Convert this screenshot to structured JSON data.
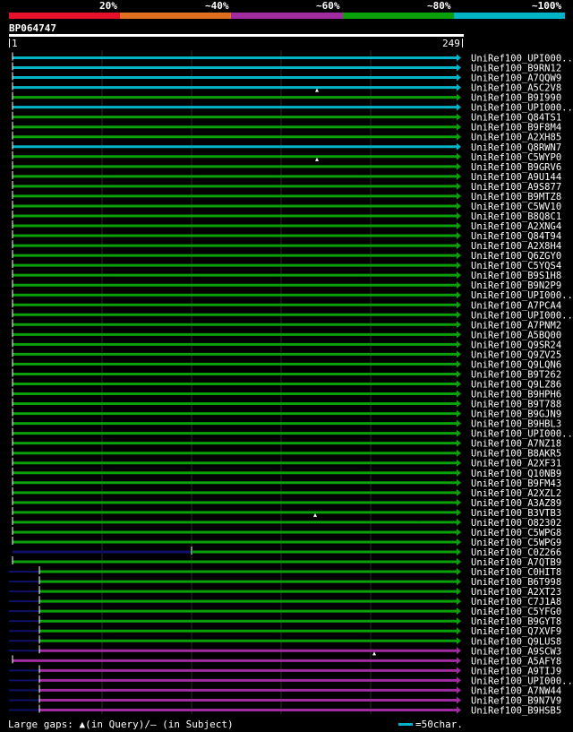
{
  "scale": {
    "labels": [
      "20%",
      "~40%",
      "~60%",
      "~80%",
      "~100%"
    ],
    "colors": [
      "#e8102a",
      "#e07020",
      "#a02ca0",
      "#0aa00a",
      "#00b4c8"
    ]
  },
  "query": {
    "id": "BP064747",
    "start": "1",
    "end": "249"
  },
  "footer": {
    "gaps_text": "Large gaps: ▲(in Query)/— (in Subject)",
    "key_text": "=50char."
  },
  "chart_data": {
    "type": "alignment",
    "query_length": 249,
    "hits": [
      {
        "name": "UniRef100_UPI000..",
        "start": 1,
        "end": 249,
        "identity": 100
      },
      {
        "name": "UniRef100_B9RN12",
        "start": 1,
        "end": 249,
        "identity": 100
      },
      {
        "name": "UniRef100_A7QQW9",
        "start": 1,
        "end": 249,
        "identity": 100
      },
      {
        "name": "UniRef100_A5C2V8",
        "start": 1,
        "end": 249,
        "identity": 100
      },
      {
        "name": "UniRef100_B9I990",
        "start": 1,
        "end": 249,
        "identity": 80,
        "query_gap_at": 171
      },
      {
        "name": "UniRef100_UPI000..",
        "start": 1,
        "end": 249,
        "identity": 100
      },
      {
        "name": "UniRef100_Q84TS1",
        "start": 1,
        "end": 249,
        "identity": 80
      },
      {
        "name": "UniRef100_B9F8M4",
        "start": 1,
        "end": 249,
        "identity": 80
      },
      {
        "name": "UniRef100_A2XH85",
        "start": 1,
        "end": 249,
        "identity": 80
      },
      {
        "name": "UniRef100_Q8RWN7",
        "start": 1,
        "end": 249,
        "identity": 100
      },
      {
        "name": "UniRef100_C5WYP0",
        "start": 1,
        "end": 249,
        "identity": 80
      },
      {
        "name": "UniRef100_B9GRV6",
        "start": 1,
        "end": 249,
        "identity": 80,
        "query_gap_at": 171
      },
      {
        "name": "UniRef100_A9U144",
        "start": 1,
        "end": 249,
        "identity": 80
      },
      {
        "name": "UniRef100_A9S877",
        "start": 1,
        "end": 249,
        "identity": 80
      },
      {
        "name": "UniRef100_B9MTZ8",
        "start": 1,
        "end": 249,
        "identity": 80
      },
      {
        "name": "UniRef100_C5WV10",
        "start": 1,
        "end": 249,
        "identity": 80
      },
      {
        "name": "UniRef100_B8Q8C1",
        "start": 1,
        "end": 249,
        "identity": 80
      },
      {
        "name": "UniRef100_A2XNG4",
        "start": 1,
        "end": 249,
        "identity": 80
      },
      {
        "name": "UniRef100_Q84T94",
        "start": 1,
        "end": 249,
        "identity": 80
      },
      {
        "name": "UniRef100_A2X8H4",
        "start": 1,
        "end": 249,
        "identity": 80
      },
      {
        "name": "UniRef100_Q6ZGY0",
        "start": 1,
        "end": 249,
        "identity": 80
      },
      {
        "name": "UniRef100_C5YQS4",
        "start": 1,
        "end": 249,
        "identity": 80
      },
      {
        "name": "UniRef100_B9S1H8",
        "start": 1,
        "end": 249,
        "identity": 80
      },
      {
        "name": "UniRef100_B9N2P9",
        "start": 1,
        "end": 249,
        "identity": 80
      },
      {
        "name": "UniRef100_UPI000..",
        "start": 1,
        "end": 249,
        "identity": 80
      },
      {
        "name": "UniRef100_A7PCA4",
        "start": 1,
        "end": 249,
        "identity": 80
      },
      {
        "name": "UniRef100_UPI000..",
        "start": 1,
        "end": 249,
        "identity": 80
      },
      {
        "name": "UniRef100_A7PNM2",
        "start": 1,
        "end": 249,
        "identity": 80
      },
      {
        "name": "UniRef100_A5BQ00",
        "start": 1,
        "end": 249,
        "identity": 80
      },
      {
        "name": "UniRef100_Q9SR24",
        "start": 1,
        "end": 249,
        "identity": 80
      },
      {
        "name": "UniRef100_Q9ZV25",
        "start": 1,
        "end": 249,
        "identity": 80
      },
      {
        "name": "UniRef100_Q9LQN6",
        "start": 1,
        "end": 249,
        "identity": 80
      },
      {
        "name": "UniRef100_B9T262",
        "start": 1,
        "end": 249,
        "identity": 80
      },
      {
        "name": "UniRef100_Q9LZ86",
        "start": 1,
        "end": 249,
        "identity": 80
      },
      {
        "name": "UniRef100_B9HPH6",
        "start": 1,
        "end": 249,
        "identity": 80
      },
      {
        "name": "UniRef100_B9T788",
        "start": 1,
        "end": 249,
        "identity": 80
      },
      {
        "name": "UniRef100_B9GJN9",
        "start": 1,
        "end": 249,
        "identity": 80
      },
      {
        "name": "UniRef100_B9HBL3",
        "start": 1,
        "end": 249,
        "identity": 80
      },
      {
        "name": "UniRef100_UPI000..",
        "start": 1,
        "end": 249,
        "identity": 80
      },
      {
        "name": "UniRef100_A7NZ18",
        "start": 1,
        "end": 249,
        "identity": 80
      },
      {
        "name": "UniRef100_B8AKR5",
        "start": 1,
        "end": 249,
        "identity": 80
      },
      {
        "name": "UniRef100_A2XF31",
        "start": 1,
        "end": 249,
        "identity": 80
      },
      {
        "name": "UniRef100_Q10NB9",
        "start": 1,
        "end": 249,
        "identity": 80
      },
      {
        "name": "UniRef100_B9FM43",
        "start": 1,
        "end": 249,
        "identity": 80
      },
      {
        "name": "UniRef100_A2XZL2",
        "start": 1,
        "end": 249,
        "identity": 80
      },
      {
        "name": "UniRef100_A3AZ89",
        "start": 1,
        "end": 249,
        "identity": 80
      },
      {
        "name": "UniRef100_B3VTB3",
        "start": 1,
        "end": 249,
        "identity": 80
      },
      {
        "name": "UniRef100_O82302",
        "start": 1,
        "end": 249,
        "identity": 80,
        "query_gap_at": 170,
        "subject_gap_at": 228
      },
      {
        "name": "UniRef100_C5WPG8",
        "start": 1,
        "end": 249,
        "identity": 80
      },
      {
        "name": "UniRef100_C5WPG9",
        "start": 1,
        "end": 249,
        "identity": 80
      },
      {
        "name": "UniRef100_C0Z266",
        "start": 1,
        "end": 249,
        "identity": 80,
        "dark_until": 101
      },
      {
        "name": "UniRef100_A7QTB9",
        "start": 1,
        "end": 249,
        "identity": 80
      },
      {
        "name": "UniRef100_C0HIT8",
        "start": 16,
        "end": 249,
        "identity": 80
      },
      {
        "name": "UniRef100_B6T998",
        "start": 16,
        "end": 249,
        "identity": 80
      },
      {
        "name": "UniRef100_A2XT23",
        "start": 16,
        "end": 249,
        "identity": 80
      },
      {
        "name": "UniRef100_C7J1A8",
        "start": 16,
        "end": 249,
        "identity": 80
      },
      {
        "name": "UniRef100_C5YFG0",
        "start": 16,
        "end": 249,
        "identity": 80
      },
      {
        "name": "UniRef100_B9GYT8",
        "start": 16,
        "end": 249,
        "identity": 80
      },
      {
        "name": "UniRef100_Q7XVF9",
        "start": 16,
        "end": 249,
        "identity": 80
      },
      {
        "name": "UniRef100_Q9LUS8",
        "start": 16,
        "end": 249,
        "identity": 80
      },
      {
        "name": "UniRef100_A9SCW3",
        "start": 16,
        "end": 249,
        "identity": 60
      },
      {
        "name": "UniRef100_A5AFY8",
        "start": 1,
        "end": 249,
        "identity": 60,
        "query_gap_at": 203
      },
      {
        "name": "UniRef100_A9TIJ9",
        "start": 16,
        "end": 249,
        "identity": 60
      },
      {
        "name": "UniRef100_UPI000..",
        "start": 16,
        "end": 249,
        "identity": 60
      },
      {
        "name": "UniRef100_A7NW44",
        "start": 16,
        "end": 249,
        "identity": 60
      },
      {
        "name": "UniRef100_B9N7V9",
        "start": 16,
        "end": 249,
        "identity": 60
      },
      {
        "name": "UniRef100_B9HSB5",
        "start": 16,
        "end": 249,
        "identity": 60
      }
    ]
  }
}
